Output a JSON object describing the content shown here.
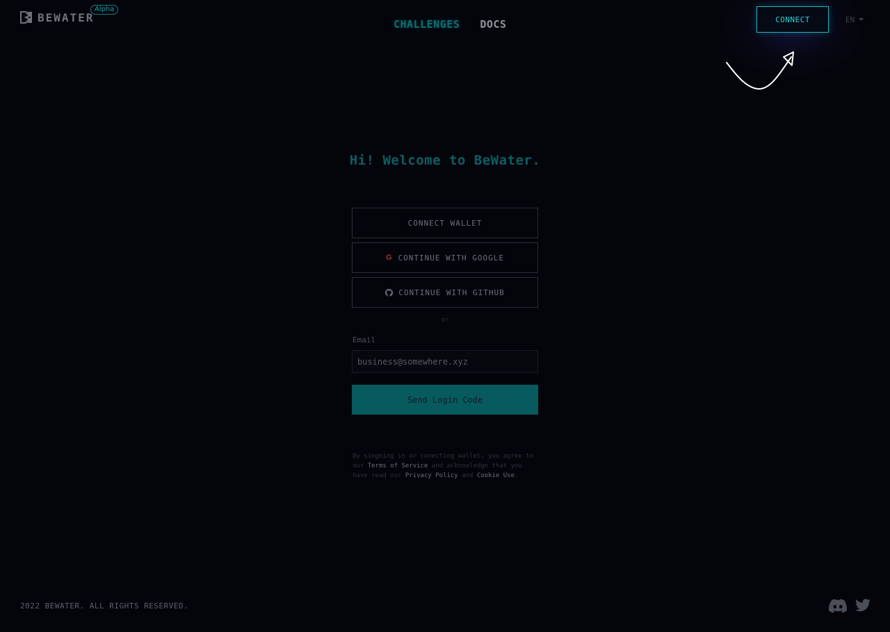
{
  "header": {
    "brand": "BEWATER",
    "badge": "Alpha",
    "nav": [
      {
        "label": "CHALLENGES",
        "active": true
      },
      {
        "label": "DOCS",
        "active": false
      }
    ],
    "connect_label": "CONNECT",
    "language": "EN",
    "icons": {
      "logo": "bewater-logo-icon",
      "lang_caret": "caret-down-icon",
      "arrow": "hand-drawn-arrow-icon"
    }
  },
  "main": {
    "welcome": "Hi! Welcome to BeWater.",
    "buttons": {
      "wallet": "CONNECT WALLET",
      "google": "CONTINUE WITH GOOGLE",
      "github": "CONTINUE WITH GITHUB"
    },
    "or": "or",
    "email": {
      "label": "Email",
      "value": "business@somewhere.xyz"
    },
    "send_label": "Send Login Code",
    "legal": {
      "part1": "By singning in or conecting wallet, you agree to our ",
      "terms": "Terms of Service",
      "part2": " and acknowledge that you have read our ",
      "privacy": "Privacy Policy",
      "part3": " and ",
      "cookie": "Cookie Use",
      "part4": "."
    }
  },
  "footer": {
    "copyright": "2022 BEWATER. ALL RIGHTS RESERVED.",
    "icons": [
      "discord-icon",
      "twitter-icon"
    ]
  },
  "colors": {
    "background": "#04050b",
    "accent": "#21b6c4",
    "primary_button": "#075a5e",
    "welcome_text": "#0d5e63"
  }
}
